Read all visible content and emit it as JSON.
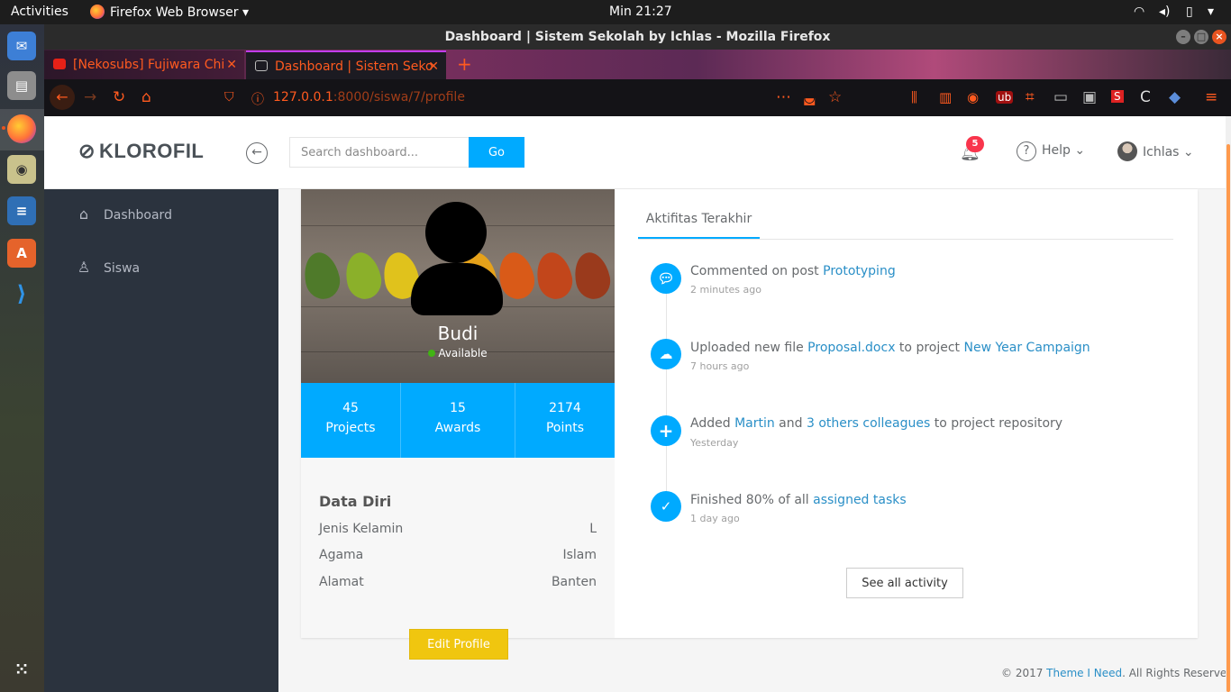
{
  "system": {
    "activities": "Activities",
    "app_menu": "Firefox Web Browser ▾",
    "clock": "Min 21:27"
  },
  "window": {
    "title": "Dashboard | Sistem Sekolah by Ichlas - Mozilla Firefox"
  },
  "tabs": [
    {
      "label": "[Nekosubs] Fujiwara Chi"
    },
    {
      "label": "Dashboard | Sistem Seko"
    }
  ],
  "urlbar": {
    "host": "127.0.0.1",
    "path": ":8000/siswa/7/profile"
  },
  "header": {
    "brand": "KLOROFIL",
    "search_placeholder": "Search dashboard...",
    "search_button": "Go",
    "notif_count": "5",
    "help": "Help",
    "user": "Ichlas"
  },
  "sidebar": {
    "items": [
      {
        "label": "Dashboard"
      },
      {
        "label": "Siswa"
      }
    ]
  },
  "profile": {
    "name": "Budi",
    "status": "Available",
    "stats": [
      {
        "num": "45",
        "label": "Projects"
      },
      {
        "num": "15",
        "label": "Awards"
      },
      {
        "num": "2174",
        "label": "Points"
      }
    ],
    "section_title": "Data Diri",
    "rows": [
      {
        "label": "Jenis Kelamin",
        "value": "L"
      },
      {
        "label": "Agama",
        "value": "Islam"
      },
      {
        "label": "Alamat",
        "value": "Banten"
      }
    ],
    "edit_button": "Edit Profile"
  },
  "activity": {
    "tab": "Aktifitas Terakhir",
    "items": [
      {
        "pre": "Commented on post ",
        "link1": "Prototyping",
        "mid": "",
        "link2": "",
        "time": "2 minutes ago"
      },
      {
        "pre": "Uploaded new file ",
        "link1": "Proposal.docx",
        "mid": " to project ",
        "link2": "New Year Campaign",
        "time": "7 hours ago"
      },
      {
        "pre": "Added ",
        "link1": "Martin",
        "mid": " and ",
        "link2": "3 others colleagues",
        "post": " to project repository",
        "time": "Yesterday"
      },
      {
        "pre": "Finished 80% of all ",
        "link1": "assigned tasks",
        "mid": "",
        "link2": "",
        "time": "1 day ago"
      }
    ],
    "see_all": "See all activity"
  },
  "footer": {
    "pre": "© 2017 ",
    "link": "Theme I Need",
    "post": ". All Rights Reserved."
  },
  "colors": {
    "accent": "#00aaff",
    "sidebar": "#2b333e",
    "warning": "#f0c60f",
    "firefox_accent": "#ff5a1f"
  }
}
